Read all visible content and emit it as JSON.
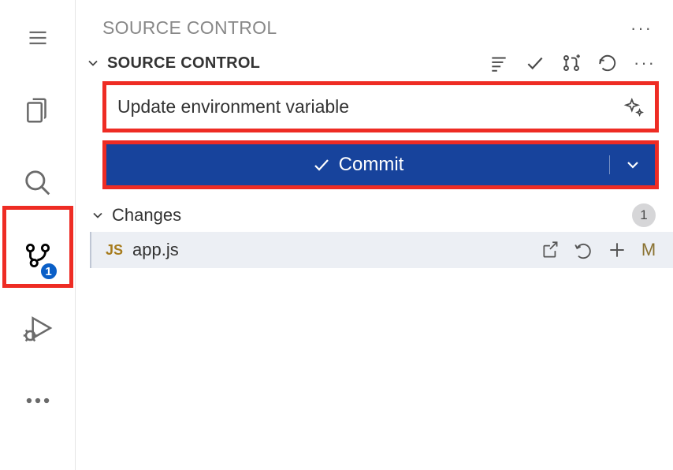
{
  "activity": {
    "scm_badge": "1"
  },
  "panel": {
    "title": "SOURCE CONTROL"
  },
  "section": {
    "title": "SOURCE CONTROL"
  },
  "commit": {
    "message": "Update environment variable",
    "button_label": "Commit"
  },
  "changes": {
    "label": "Changes",
    "count": "1",
    "files": [
      {
        "lang": "JS",
        "name": "app.js",
        "status": "M"
      }
    ]
  }
}
